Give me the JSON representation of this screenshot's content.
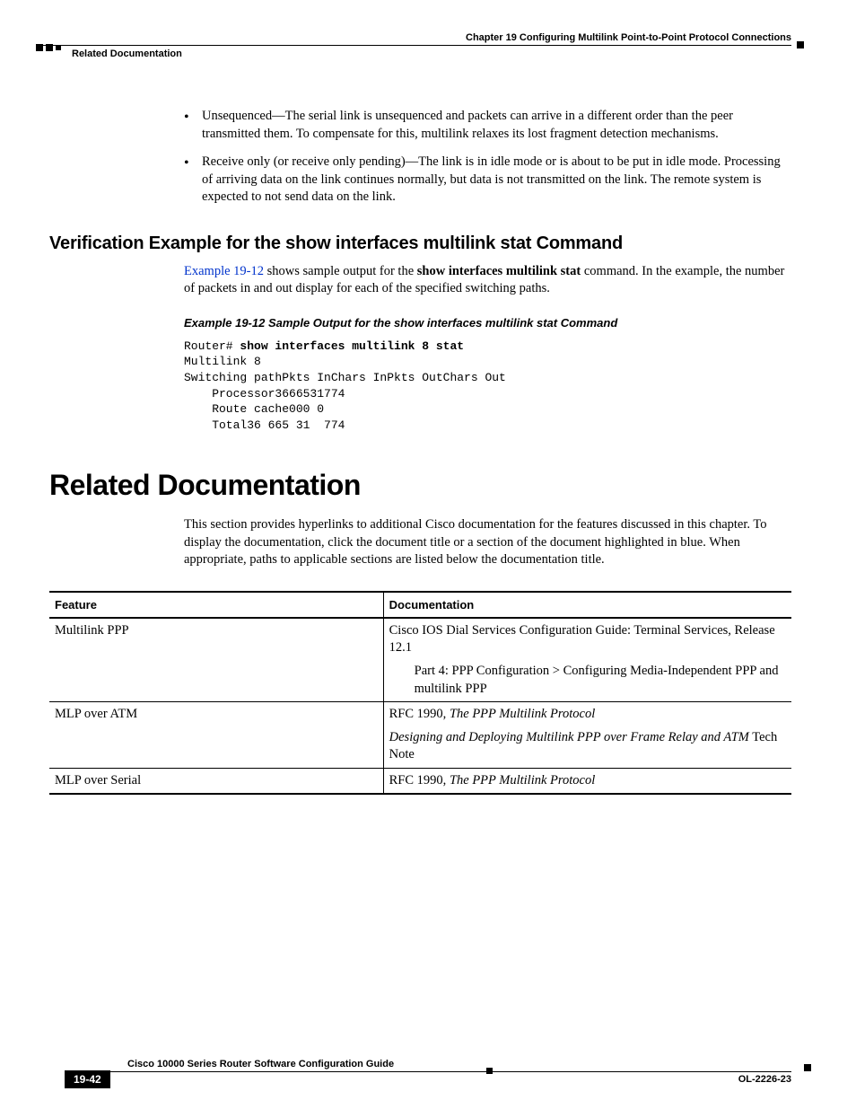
{
  "header": {
    "chapter": "Chapter 19      Configuring Multilink Point-to-Point Protocol Connections",
    "section": "Related Documentation"
  },
  "bullets": [
    "Unsequenced—The serial link is unsequenced and packets can arrive in a different order than the peer transmitted them. To compensate for this, multilink relaxes its lost fragment detection mechanisms.",
    "Receive only (or receive only pending)—The link is in idle mode or is about to be put in idle mode. Processing of arriving data on the link continues normally, but data is not transmitted on the link. The remote system is expected to not send data on the link."
  ],
  "verification": {
    "heading": "Verification Example for the show interfaces multilink stat Command",
    "link_text": "Example 19-12",
    "para_pre": " shows sample output for the ",
    "cmd_bold": "show interfaces multilink stat",
    "para_post": " command. In the example, the number of packets in and out display for each of the specified switching paths.",
    "example_title": "Example 19-12 Sample Output for the show interfaces multilink stat Command",
    "code_prompt": "Router# ",
    "code_cmd": "show interfaces multilink 8 stat",
    "code_lines": [
      "Multilink 8",
      "Switching pathPkts InChars InPkts OutChars Out",
      "    Processor3666531774",
      "    Route cache000 0",
      "    Total36 665 31  774"
    ]
  },
  "related": {
    "heading": "Related Documentation",
    "para": "This section provides hyperlinks to additional Cisco documentation for the features discussed in this chapter. To display the documentation, click the document title or a section of the document highlighted in blue. When appropriate, paths to applicable sections are listed below the documentation title."
  },
  "table": {
    "headers": [
      "Feature",
      "Documentation"
    ],
    "rows": [
      {
        "feature": "Multilink PPP",
        "doc_main": "Cisco IOS Dial Services Configuration Guide: Terminal Services, Release 12.1",
        "doc_sub": "Part 4: PPP Configuration > Configuring Media-Independent PPP and multilink PPP"
      },
      {
        "feature": "MLP over ATM",
        "doc_line1_pre": "RFC 1990, ",
        "doc_line1_it": "The PPP Multilink Protocol",
        "doc_line2_it": "Designing and Deploying Multilink PPP over Frame Relay and ATM",
        "doc_line2_post": " Tech Note"
      },
      {
        "feature": "MLP over Serial",
        "doc_line1_pre": "RFC 1990, ",
        "doc_line1_it": "The PPP Multilink Protocol"
      }
    ]
  },
  "footer": {
    "title": "Cisco 10000 Series Router Software Configuration Guide",
    "page": "19-42",
    "ol": "OL-2226-23"
  }
}
